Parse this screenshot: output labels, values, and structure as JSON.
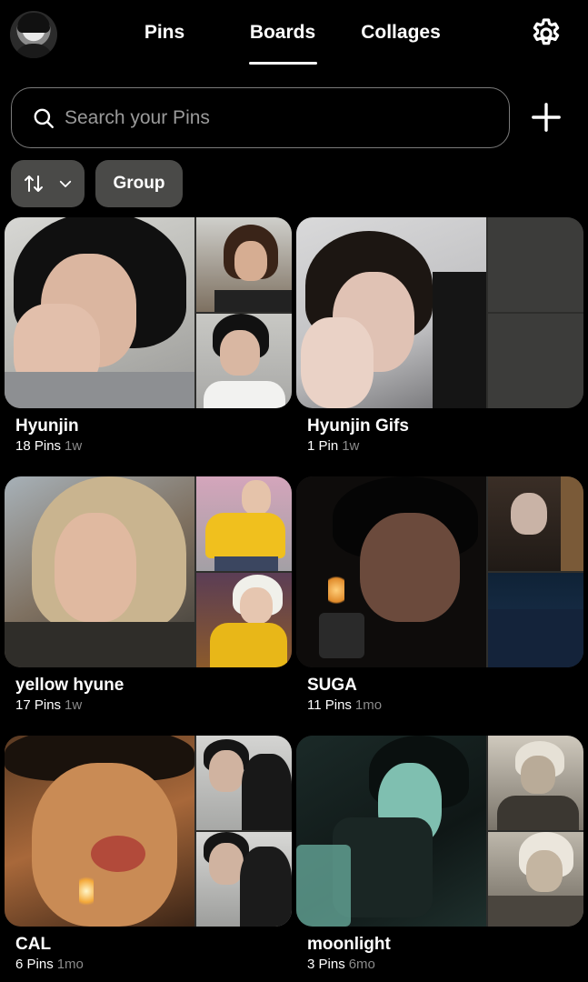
{
  "header": {
    "tabs": [
      {
        "label": "Pins"
      },
      {
        "label": "Boards",
        "active": true
      },
      {
        "label": "Collages"
      }
    ],
    "settings_icon": "gear-icon",
    "avatar_icon": "profile-avatar"
  },
  "search": {
    "placeholder": "Search your Pins",
    "icon": "search-icon",
    "add_icon": "plus-icon"
  },
  "filters": {
    "sort_icon": "sort-arrows-icon",
    "dropdown_icon": "chevron-down-icon",
    "group_label": "Group"
  },
  "boards": [
    {
      "title": "Hyunjin",
      "pins": "18 Pins",
      "age": "1w"
    },
    {
      "title": "Hyunjin Gifs",
      "pins": "1 Pin",
      "age": "1w"
    },
    {
      "title": "yellow hyune",
      "pins": "17 Pins",
      "age": "1w"
    },
    {
      "title": "SUGA",
      "pins": "11 Pins",
      "age": "1mo"
    },
    {
      "title": "CAL",
      "pins": "6 Pins",
      "age": "1mo"
    },
    {
      "title": "moonlight",
      "pins": "3 Pins",
      "age": "6mo"
    }
  ],
  "colors": {
    "background": "#000000",
    "chip": "#4a4a48",
    "muted_text": "#8a8a8a",
    "empty_tile": "#3c3c3a"
  }
}
